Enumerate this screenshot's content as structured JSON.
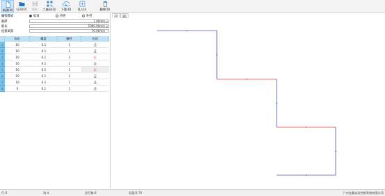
{
  "toolbar": {
    "buttons": [
      {
        "label": "新建(N)",
        "icon": "new-file-icon",
        "active": true,
        "enabled": true
      },
      {
        "label": "打开(O)",
        "icon": "open-folder-icon",
        "active": false,
        "enabled": true
      },
      {
        "label": "保存",
        "icon": "save-icon",
        "active": false,
        "enabled": false
      },
      {
        "label": "二维码(Q)",
        "icon": "qr-code-icon",
        "active": false,
        "enabled": true
      },
      {
        "label": "下载(D)",
        "icon": "cloud-download-icon",
        "active": false,
        "enabled": true
      },
      {
        "label": "导入(I)",
        "icon": "import-icon",
        "active": false,
        "enabled": true
      },
      {
        "label": "删除(D)",
        "icon": "trash-icon",
        "active": false,
        "enabled": true
      }
    ]
  },
  "form": {
    "mode_label": "编程模式",
    "mode_options": [
      "标准",
      "内径",
      "外径"
    ],
    "mode_selected": 0,
    "thickness_label": "板厚",
    "thickness_value": "1.00mm",
    "length_label": "板长",
    "length_value": "1000.00mm",
    "max_label": "挂板高宽",
    "max_value": "70.00mm"
  },
  "table": {
    "headers": [
      "边长",
      "精度",
      "循环",
      "方向"
    ],
    "rows": [
      {
        "num": "1",
        "cells": [
          "10",
          "0.1",
          "1",
          "正"
        ],
        "red": false,
        "highlight": false
      },
      {
        "num": "2",
        "cells": [
          "10",
          "0.1",
          "1",
          "正"
        ],
        "red": false,
        "highlight": false
      },
      {
        "num": "3",
        "cells": [
          "10",
          "0.1",
          "1",
          "反"
        ],
        "red": true,
        "highlight": false
      },
      {
        "num": "4",
        "cells": [
          "10",
          "0.1",
          "1",
          "正"
        ],
        "red": false,
        "highlight": false
      },
      {
        "num": "5",
        "cells": [
          "10",
          "0.1",
          "1",
          "反"
        ],
        "red": true,
        "highlight": true
      },
      {
        "num": "6",
        "cells": [
          "10",
          "0.1",
          "1",
          "正"
        ],
        "red": false,
        "highlight": false
      },
      {
        "num": "7",
        "cells": [
          "10",
          "0.1",
          "1",
          "正"
        ],
        "red": false,
        "highlight": false
      },
      {
        "num": "8",
        "cells": [
          "0",
          "0.1",
          "1",
          "正"
        ],
        "red": false,
        "highlight": false
      }
    ]
  },
  "preview": {
    "tabs": [
      "2D",
      "3D"
    ],
    "active_tab": 0,
    "colors": {
      "forward": "#4a55c8",
      "reverse": "#e24848"
    },
    "segments": [
      "forward",
      "forward",
      "reverse",
      "forward",
      "reverse",
      "forward",
      "forward"
    ]
  },
  "status": {
    "row": "行:0",
    "col": "列:4",
    "total": "总行数:8",
    "total_len": "总展开:70",
    "company": "广州红圆自动控制系统有限公司"
  }
}
